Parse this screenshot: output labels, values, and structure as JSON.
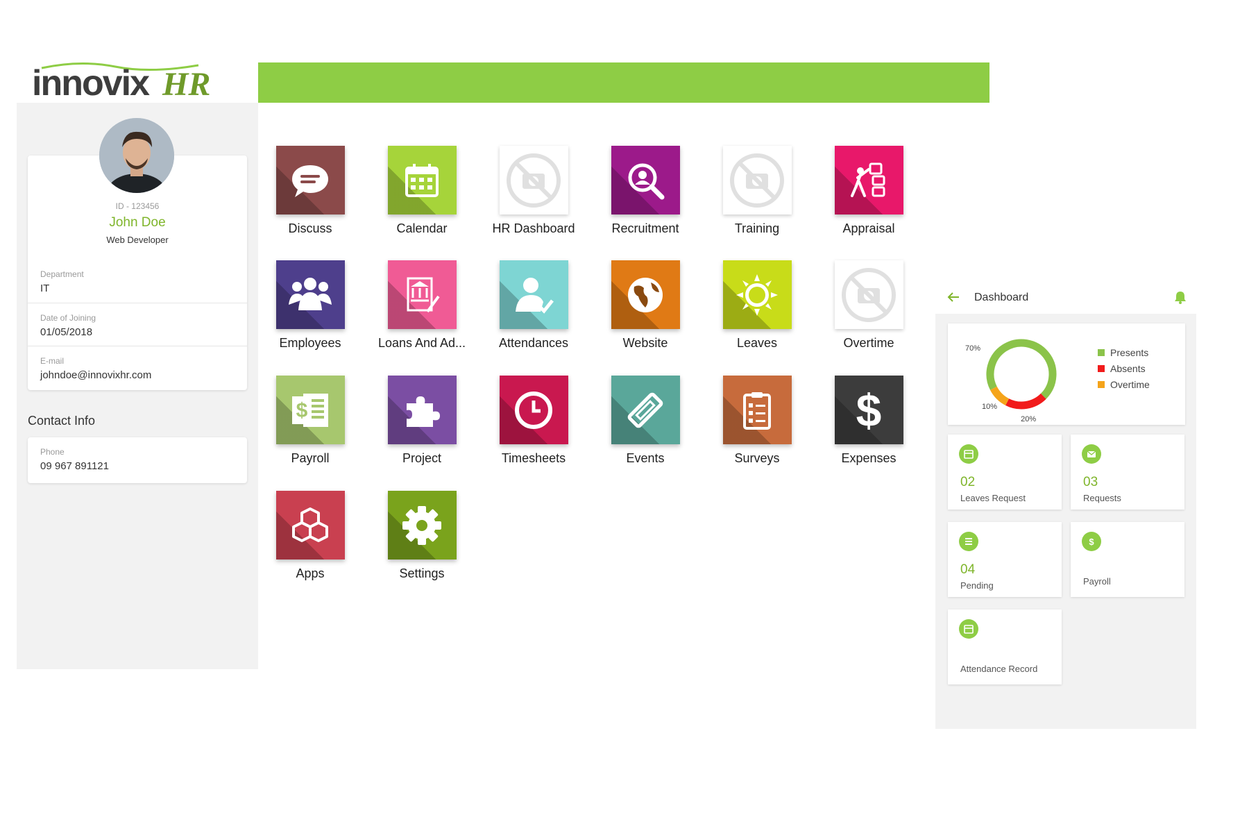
{
  "brand": {
    "name": "innovix",
    "suffix": "HR",
    "accent": "#8ecd45"
  },
  "profile": {
    "id": "ID - 123456",
    "name": "John Doe",
    "role": "Web Developer",
    "fields": [
      {
        "label": "Department",
        "value": "IT"
      },
      {
        "label": "Date of Joining",
        "value": "01/05/2018"
      },
      {
        "label": "E-mail",
        "value": "johndoe@innovixhr.com"
      }
    ],
    "contact_title": "Contact Info",
    "phone": {
      "label": "Phone",
      "value": "09 967 891121"
    }
  },
  "apps": [
    {
      "label": "Discuss",
      "icon": "chat-bubble-icon",
      "color": "#8b4a4a"
    },
    {
      "label": "Calendar",
      "icon": "calendar-icon",
      "color": "#a6d43a"
    },
    {
      "label": "HR Dashboard",
      "icon": "no-image-icon",
      "color": "placeholder"
    },
    {
      "label": "Recruitment",
      "icon": "magnifier-person-icon",
      "color": "#9c1a8a"
    },
    {
      "label": "Training",
      "icon": "no-image-icon",
      "color": "placeholder"
    },
    {
      "label": "Appraisal",
      "icon": "appraisal-icon",
      "color": "#e8186a"
    },
    {
      "label": "Employees",
      "icon": "people-group-icon",
      "color": "#4e3f8c"
    },
    {
      "label": "Loans And Ad...",
      "icon": "bank-document-icon",
      "color": "#f05b95"
    },
    {
      "label": "Attendances",
      "icon": "user-check-icon",
      "color": "#7ed5d3"
    },
    {
      "label": "Website",
      "icon": "globe-icon",
      "color": "#e07a15"
    },
    {
      "label": "Leaves",
      "icon": "sun-icon",
      "color": "#c8dc19"
    },
    {
      "label": "Overtime",
      "icon": "no-image-icon",
      "color": "placeholder"
    },
    {
      "label": "Payroll",
      "icon": "payroll-sheet-icon",
      "color": "#a7c76e"
    },
    {
      "label": "Project",
      "icon": "puzzle-icon",
      "color": "#7b4ea3"
    },
    {
      "label": "Timesheets",
      "icon": "clock-icon",
      "color": "#c9184f"
    },
    {
      "label": "Events",
      "icon": "ticket-icon",
      "color": "#5aa79a"
    },
    {
      "label": "Surveys",
      "icon": "clipboard-list-icon",
      "color": "#c76b3c"
    },
    {
      "label": "Expenses",
      "icon": "dollar-icon",
      "color": "#3c3c3c"
    },
    {
      "label": "Apps",
      "icon": "cubes-icon",
      "color": "#c94050"
    },
    {
      "label": "Settings",
      "icon": "gear-icon",
      "color": "#7aa31c"
    }
  ],
  "dashboard": {
    "title": "Dashboard",
    "back_icon": "arrow-left-icon",
    "bell_icon": "bell-icon",
    "chart_data": {
      "type": "pie",
      "categories": [
        "Presents",
        "Absents",
        "Overtime"
      ],
      "values": [
        70,
        20,
        10
      ],
      "value_labels": [
        "70%",
        "20%",
        "10%"
      ],
      "colors": [
        "#8bc34a",
        "#f11b1b",
        "#f5a41a"
      ],
      "legend": "right"
    },
    "cards": [
      {
        "number": "02",
        "label": "Leaves Request",
        "icon": "calendar-icon"
      },
      {
        "number": "03",
        "label": "Requests",
        "icon": "envelope-icon"
      },
      {
        "number": "04",
        "label": "Pending",
        "icon": "list-icon"
      },
      {
        "number": "",
        "label": "Payroll",
        "icon": "dollar-icon"
      },
      {
        "number": "",
        "label": "Attendance Record",
        "icon": "calendar-icon"
      }
    ]
  }
}
